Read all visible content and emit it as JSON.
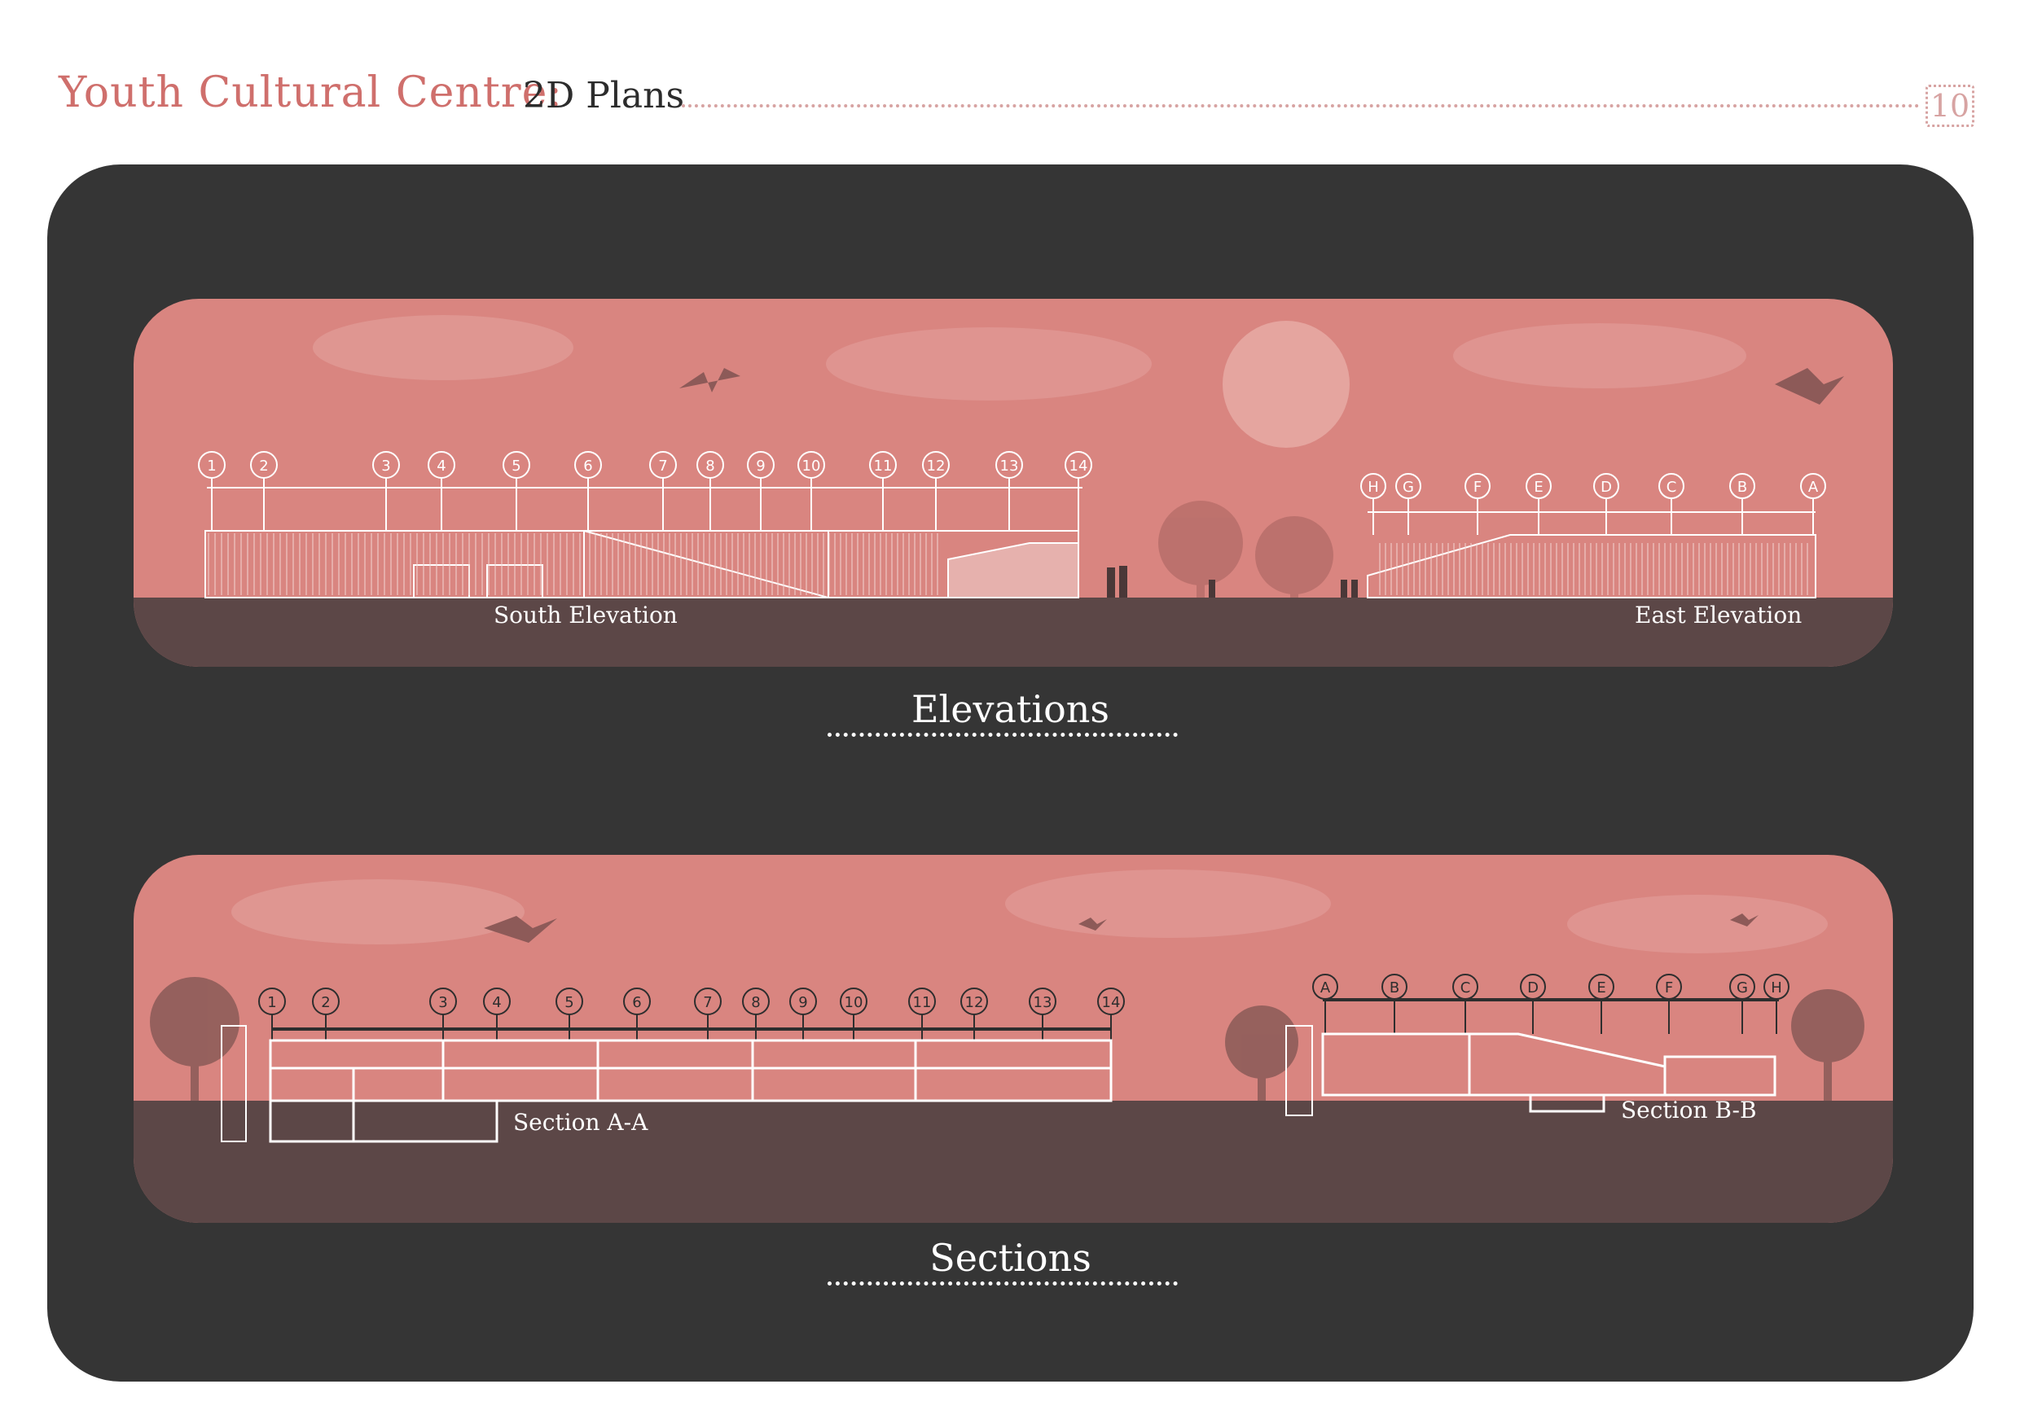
{
  "header": {
    "title_accent": "Youth Cultural Centre:",
    "title_main": "2D Plans",
    "page_number": "10"
  },
  "elevations": {
    "heading": "Elevations",
    "labels": {
      "south": "South Elevation",
      "east": "East Elevation"
    },
    "south_grid": [
      "1",
      "2",
      "3",
      "4",
      "5",
      "6",
      "7",
      "8",
      "9",
      "10",
      "11",
      "12",
      "13",
      "14"
    ],
    "east_grid": [
      "H",
      "G",
      "F",
      "E",
      "D",
      "C",
      "B",
      "A"
    ]
  },
  "sections": {
    "heading": "Sections",
    "labels": {
      "a": "Section A-A",
      "b": "Section B-B"
    },
    "a_grid": [
      "1",
      "2",
      "3",
      "4",
      "5",
      "6",
      "7",
      "8",
      "9",
      "10",
      "11",
      "12",
      "13",
      "14"
    ],
    "b_grid": [
      "A",
      "B",
      "C",
      "D",
      "E",
      "F",
      "G",
      "H"
    ]
  },
  "colors": {
    "accent": "#cf6f6c",
    "board": "#353535",
    "sky": "#d98580",
    "ground": "#5c4747",
    "line": "#ffffff"
  }
}
